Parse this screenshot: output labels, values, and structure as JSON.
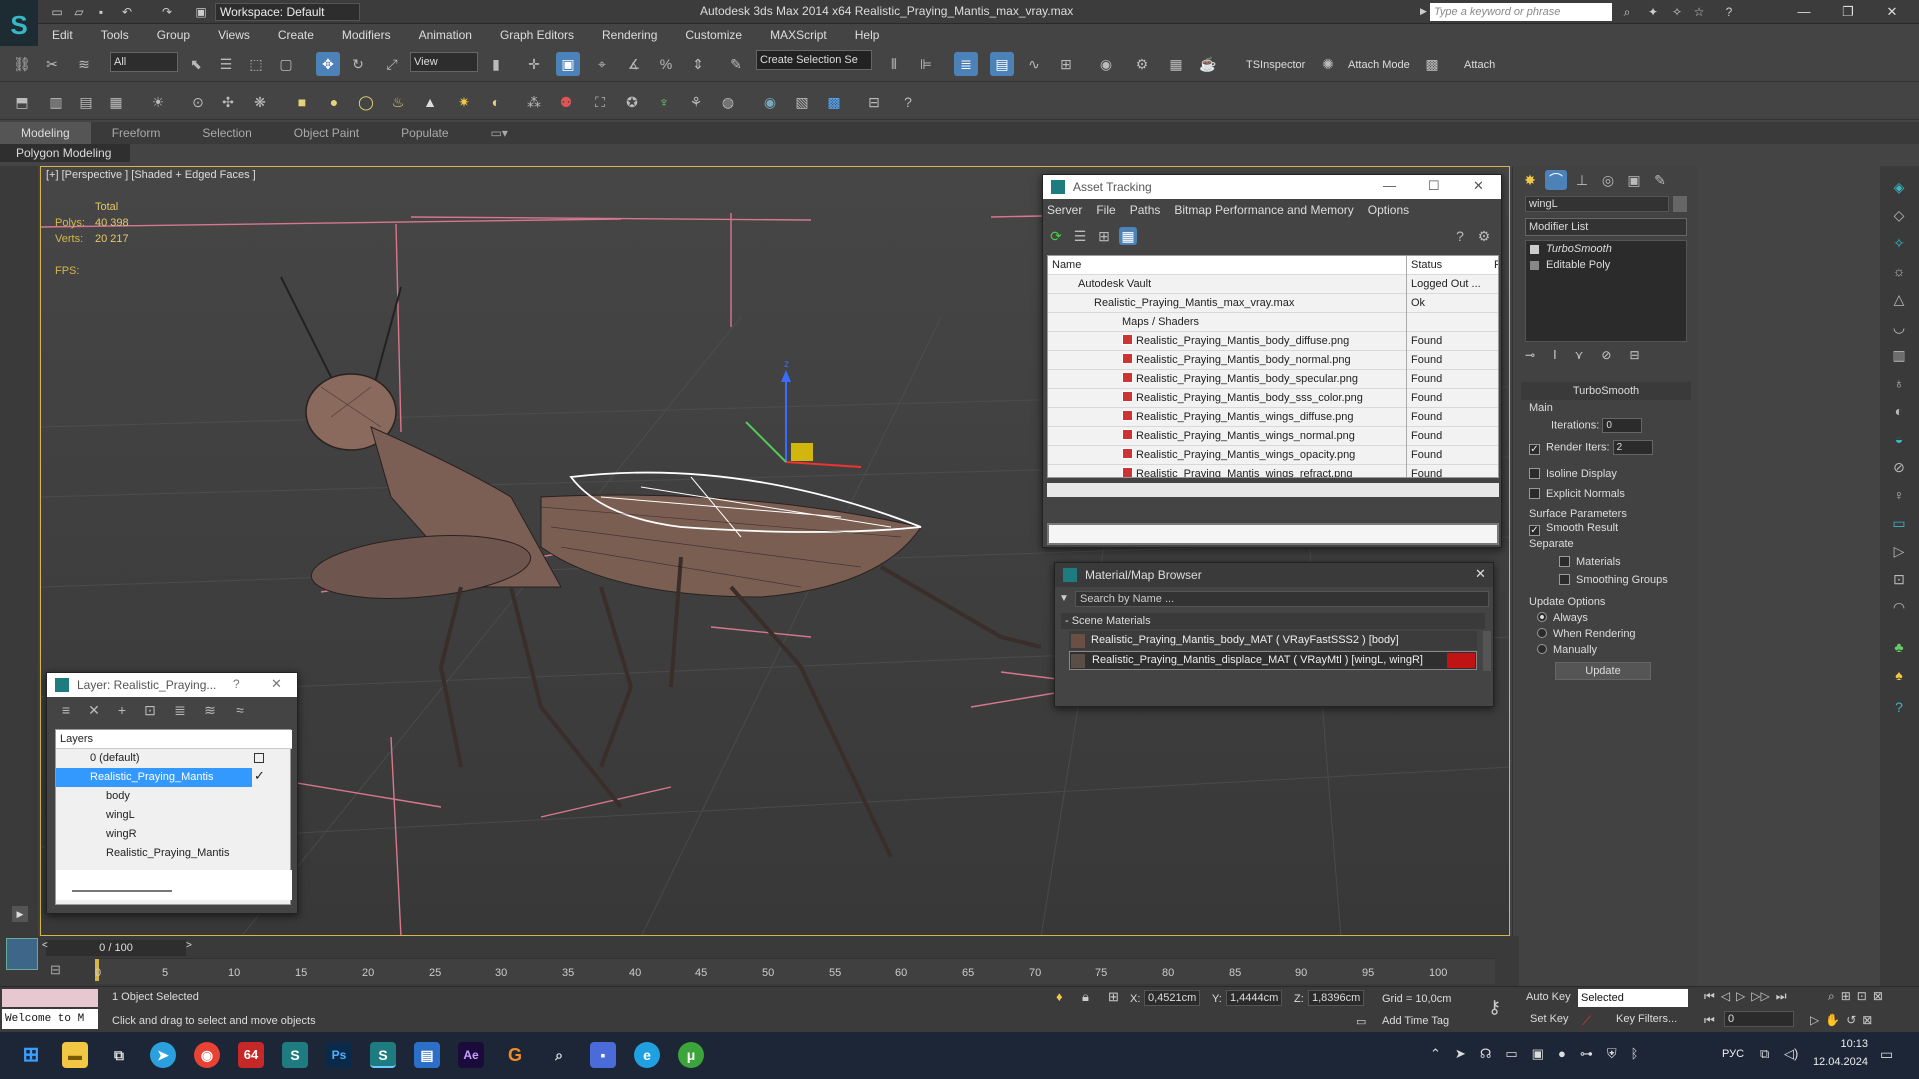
{
  "app": {
    "title": "Autodesk 3ds Max  2014 x64    Realistic_Praying_Mantis_max_vray.max",
    "workspace": "Workspace: Default",
    "search_placeholder": "Type a keyword or phrase"
  },
  "menu": [
    "Edit",
    "Tools",
    "Group",
    "Views",
    "Create",
    "Modifiers",
    "Animation",
    "Graph Editors",
    "Rendering",
    "Customize",
    "MAXScript",
    "Help"
  ],
  "toolbar": {
    "filter": "All",
    "view": "View",
    "selection_set": "Create Selection Se",
    "tsinspector": "TSInspector",
    "attach_mode": "Attach Mode",
    "attach": "Attach"
  },
  "ribbon": {
    "tabs": [
      "Modeling",
      "Freeform",
      "Selection",
      "Object Paint",
      "Populate"
    ],
    "active": "Modeling",
    "panel": "Polygon Modeling"
  },
  "viewport": {
    "label": "[+] [Perspective ] [Shaded + Edged Faces ]",
    "total_label": "Total",
    "polys_label": "Polys:",
    "polys": "40 398",
    "verts_label": "Verts:",
    "verts": "20 217",
    "fps_label": "FPS:",
    "axis_z": "z"
  },
  "asset_tracking": {
    "title": "Asset Tracking",
    "menu": [
      "Server",
      "File",
      "Paths",
      "Bitmap Performance and Memory",
      "Options"
    ],
    "col_name": "Name",
    "col_status": "Status",
    "col_p": "P",
    "rows": [
      {
        "name": "Autodesk Vault",
        "status": "Logged Out ..."
      },
      {
        "name": "Realistic_Praying_Mantis_max_vray.max",
        "status": "Ok"
      },
      {
        "name": "Maps / Shaders",
        "status": ""
      },
      {
        "name": "Realistic_Praying_Mantis_body_diffuse.png",
        "status": "Found"
      },
      {
        "name": "Realistic_Praying_Mantis_body_normal.png",
        "status": "Found"
      },
      {
        "name": "Realistic_Praying_Mantis_body_specular.png",
        "status": "Found"
      },
      {
        "name": "Realistic_Praying_Mantis_body_sss_color.png",
        "status": "Found"
      },
      {
        "name": "Realistic_Praying_Mantis_wings_diffuse.png",
        "status": "Found"
      },
      {
        "name": "Realistic_Praying_Mantis_wings_normal.png",
        "status": "Found"
      },
      {
        "name": "Realistic_Praying_Mantis_wings_opacity.png",
        "status": "Found"
      },
      {
        "name": "Realistic_Praying_Mantis_wings_refract.png",
        "status": "Found"
      }
    ]
  },
  "material_browser": {
    "title": "Material/Map Browser",
    "search": "Search by Name ...",
    "section": "- Scene Materials",
    "items": [
      "Realistic_Praying_Mantis_body_MAT ( VRayFastSSS2 ) [body]",
      "Realistic_Praying_Mantis_displace_MAT ( VRayMtl ) [wingL, wingR]"
    ]
  },
  "layer_panel": {
    "title": "Layer: Realistic_Praying...",
    "help": "?",
    "header": "Layers",
    "rows": [
      "0 (default)",
      "Realistic_Praying_Mantis",
      "body",
      "wingL",
      "wingR",
      "Realistic_Praying_Mantis"
    ]
  },
  "command_panel": {
    "object_name": "wingL",
    "modifier_list": "Modifier List",
    "stack": [
      "TurboSmooth",
      "Editable Poly"
    ],
    "rollout_title": "TurboSmooth",
    "main_label": "Main",
    "iterations_label": "Iterations:",
    "iterations": "0",
    "render_iters_label": "Render Iters:",
    "render_iters": "2",
    "isoline": "Isoline Display",
    "explicit_normals": "Explicit Normals",
    "surface_params": "Surface Parameters",
    "smooth_result": "Smooth Result",
    "separate": "Separate",
    "materials": "Materials",
    "smoothing_groups": "Smoothing Groups",
    "update_options": "Update Options",
    "always": "Always",
    "when_rendering": "When Rendering",
    "manually": "Manually",
    "update_btn": "Update"
  },
  "timeline": {
    "frame": "0 / 100",
    "ticks": [
      "0",
      "5",
      "10",
      "15",
      "20",
      "25",
      "30",
      "35",
      "40",
      "45",
      "50",
      "55",
      "60",
      "65",
      "70",
      "75",
      "80",
      "85",
      "90",
      "95",
      "100"
    ]
  },
  "status": {
    "maxscript": "Welcome to M",
    "selected": "1 Object Selected",
    "prompt": "Click and drag to select and move objects",
    "x_label": "X:",
    "x": "0,4521cm",
    "y_label": "Y:",
    "y": "1,4444cm",
    "z_label": "Z:",
    "z": "1,8396cm",
    "grid": "Grid = 10,0cm",
    "add_time_tag": "Add Time Tag",
    "auto_key": "Auto Key",
    "set_key": "Set Key",
    "selected_dd": "Selected",
    "key_filters": "Key Filters...",
    "frame_field": "0"
  },
  "taskbar": {
    "lang": "РУС",
    "time": "10:13",
    "date": "12.04.2024",
    "badge": "64"
  }
}
